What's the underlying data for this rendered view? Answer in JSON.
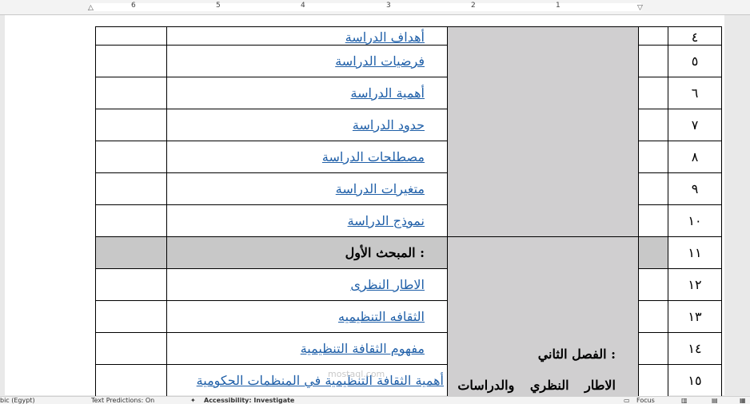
{
  "ruler": {
    "numbers": [
      "6",
      "5",
      "4",
      "3",
      "2",
      "1"
    ]
  },
  "table": {
    "rows": [
      {
        "num": "٤",
        "title": "أهداف الدراسة",
        "style": "link"
      },
      {
        "num": "٥",
        "title": "فرضيات الدراسة",
        "style": "link"
      },
      {
        "num": "٦",
        "title": "أهمية الدراسة",
        "style": "link"
      },
      {
        "num": "٧",
        "title": "حدود الدراسة",
        "style": "link"
      },
      {
        "num": "٨",
        "title": "مصطلحات الدراسة",
        "style": "link"
      },
      {
        "num": "٩",
        "title": "متغيرات الدراسة",
        "style": "link"
      },
      {
        "num": "١٠",
        "title": "نموذج الدراسة",
        "style": "link"
      },
      {
        "num": "١١",
        "title": "المبحث الأول :",
        "style": "heading"
      },
      {
        "num": "١٢",
        "title": "الاطار النظرى",
        "style": "link"
      },
      {
        "num": "١٣",
        "title": "الثقافه التنظيميه",
        "style": "link"
      },
      {
        "num": "١٤",
        "title": "مفهوم الثقافة التنظيمية",
        "style": "link",
        "chapter": "الفصل الثاني :"
      },
      {
        "num": "١٥",
        "title": "أهمية الثقافة التنظيمية في المنظمات الحكومية",
        "style": "link",
        "chapter": "الاطار النظري والدراسات"
      }
    ]
  },
  "statusbar": {
    "language": "bic (Egypt)",
    "text_predictions": "Text Predictions: On",
    "accessibility": "Accessibility: Investigate",
    "focus": "Focus"
  },
  "watermark": "mostaql.com"
}
